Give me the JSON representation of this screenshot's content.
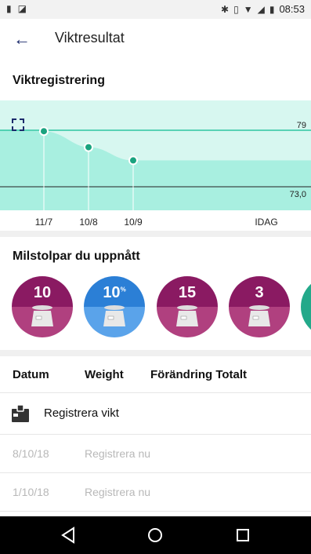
{
  "status_bar": {
    "time": "08:53"
  },
  "header": {
    "title": "Viktresultat"
  },
  "weight_section": {
    "title": "Viktregistrering"
  },
  "chart_data": {
    "type": "area",
    "x": [
      "11/7",
      "10/8",
      "10/9",
      "IDAG"
    ],
    "values": [
      78.9,
      77.2,
      75.8,
      75.8
    ],
    "reference_lines": {
      "goal_upper": "79",
      "goal_lower": "73,0"
    },
    "colors": {
      "fill": "#a8efe0",
      "band": "#d7f7f0",
      "point": "#1aa37f",
      "line": "#2fc6a1"
    }
  },
  "milestones": {
    "title": "Milstolpar du uppnått",
    "badges": [
      {
        "label": "10",
        "sup": "",
        "top_color": "#8a1a62",
        "bottom_color": "#b0407f"
      },
      {
        "label": "10",
        "sup": "%",
        "top_color": "#2b7fd6",
        "bottom_color": "#5aa3ea"
      },
      {
        "label": "15",
        "sup": "",
        "top_color": "#8a1a62",
        "bottom_color": "#b0407f"
      },
      {
        "label": "3",
        "sup": "",
        "top_color": "#8a1a62",
        "bottom_color": "#b0407f"
      }
    ]
  },
  "table": {
    "headers": {
      "date": "Datum",
      "weight": "Weight",
      "change": "Förändring Totalt"
    },
    "register_label": "Registrera vikt",
    "rows": [
      {
        "date": "8/10/18",
        "action": "Registrera nu"
      },
      {
        "date": "1/10/18",
        "action": "Registrera nu"
      }
    ]
  }
}
